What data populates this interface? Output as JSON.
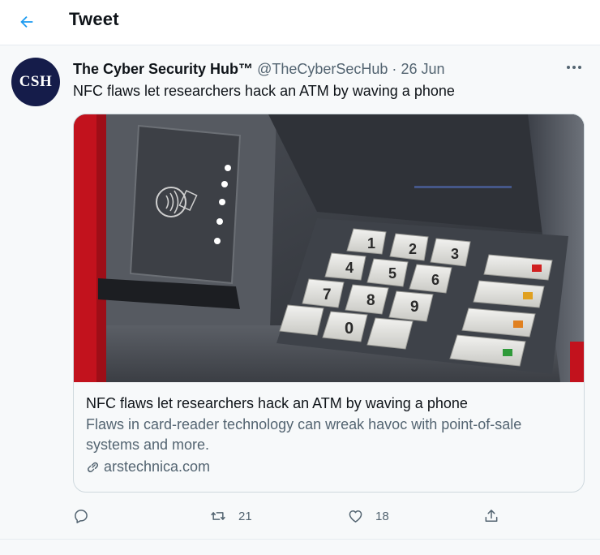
{
  "header": {
    "title": "Tweet",
    "back_icon": "arrow-left-icon",
    "accent": "#1d9bf0"
  },
  "tweet": {
    "avatar_text": "CSH",
    "avatar_color": "#151c4a",
    "author_name": "The Cyber Security Hub™",
    "author_handle": "@TheCyberSecHub",
    "separator": "·",
    "date": "26 Jun",
    "text": "NFC flaws let researchers hack an ATM by waving a phone",
    "card": {
      "image_description_icon": "atm-keypad-photo",
      "title": "NFC flaws let researchers hack an ATM by waving a phone",
      "description": "Flaws in card-reader technology can wreak havoc with point-of-sale systems and more.",
      "domain": "arstechnica.com"
    },
    "actions": {
      "reply_count": "",
      "retweet_count": "21",
      "like_count": "18"
    }
  }
}
